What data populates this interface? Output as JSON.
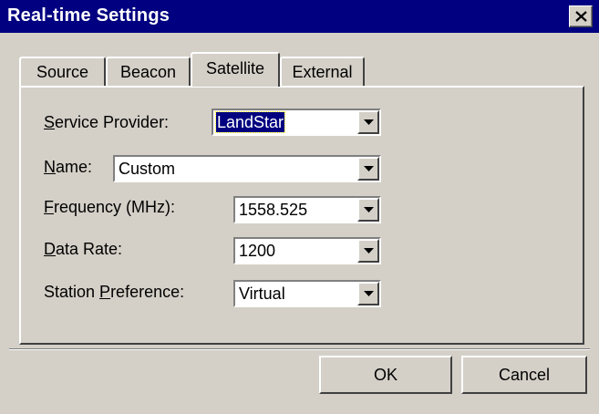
{
  "window": {
    "title": "Real-time Settings",
    "close_glyph": "✕"
  },
  "tabs": [
    {
      "label": "Source",
      "active": false
    },
    {
      "label": "Beacon",
      "active": false
    },
    {
      "label": "Satellite",
      "active": true
    },
    {
      "label": "External",
      "active": false
    }
  ],
  "fields": {
    "service_provider": {
      "label_access": "S",
      "label_rest": "ervice Provider:",
      "value": "LandStar"
    },
    "name": {
      "label_access": "N",
      "label_rest": "ame:",
      "value": "Custom"
    },
    "frequency": {
      "label_access": "F",
      "label_rest": "requency (MHz):",
      "value": "1558.525"
    },
    "data_rate": {
      "label_access": "D",
      "label_rest": "ata Rate:",
      "value": "1200"
    },
    "station_preference": {
      "label_pre": "Station ",
      "label_access": "P",
      "label_rest": "reference:",
      "value": "Virtual"
    }
  },
  "buttons": {
    "ok": "OK",
    "cancel": "Cancel"
  },
  "colors": {
    "titlebar": "#000080",
    "face": "#d4d0c8",
    "selection": "#000080"
  },
  "icons": {
    "close": "close-icon",
    "dropdown": "chevron-down-icon"
  }
}
